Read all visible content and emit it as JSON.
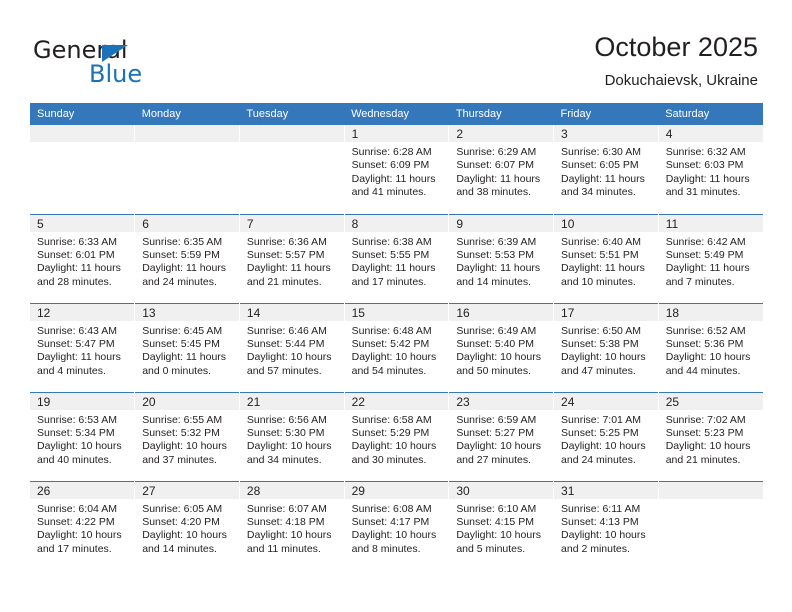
{
  "brand": {
    "name_part1": "General",
    "name_part2": "Blue",
    "accent_color": "#1b72b8"
  },
  "header": {
    "title": "October 2025",
    "subtitle": "Dokuchaievsk, Ukraine"
  },
  "calendar": {
    "header_color": "#3577bb",
    "daynum_band_color": "#f0f0f0",
    "weekday_headers": [
      "Sunday",
      "Monday",
      "Tuesday",
      "Wednesday",
      "Thursday",
      "Friday",
      "Saturday"
    ],
    "labels": {
      "sunrise_prefix": "Sunrise:",
      "sunset_prefix": "Sunset:",
      "daylight_prefix": "Daylight:"
    },
    "weeks": [
      [
        {
          "day": "",
          "empty": true
        },
        {
          "day": "",
          "empty": true
        },
        {
          "day": "",
          "empty": true
        },
        {
          "day": "1",
          "sunrise": "Sunrise: 6:28 AM",
          "sunset": "Sunset: 6:09 PM",
          "daylight": "Daylight: 11 hours and 41 minutes."
        },
        {
          "day": "2",
          "sunrise": "Sunrise: 6:29 AM",
          "sunset": "Sunset: 6:07 PM",
          "daylight": "Daylight: 11 hours and 38 minutes."
        },
        {
          "day": "3",
          "sunrise": "Sunrise: 6:30 AM",
          "sunset": "Sunset: 6:05 PM",
          "daylight": "Daylight: 11 hours and 34 minutes."
        },
        {
          "day": "4",
          "sunrise": "Sunrise: 6:32 AM",
          "sunset": "Sunset: 6:03 PM",
          "daylight": "Daylight: 11 hours and 31 minutes."
        }
      ],
      [
        {
          "day": "5",
          "sunrise": "Sunrise: 6:33 AM",
          "sunset": "Sunset: 6:01 PM",
          "daylight": "Daylight: 11 hours and 28 minutes."
        },
        {
          "day": "6",
          "sunrise": "Sunrise: 6:35 AM",
          "sunset": "Sunset: 5:59 PM",
          "daylight": "Daylight: 11 hours and 24 minutes."
        },
        {
          "day": "7",
          "sunrise": "Sunrise: 6:36 AM",
          "sunset": "Sunset: 5:57 PM",
          "daylight": "Daylight: 11 hours and 21 minutes."
        },
        {
          "day": "8",
          "sunrise": "Sunrise: 6:38 AM",
          "sunset": "Sunset: 5:55 PM",
          "daylight": "Daylight: 11 hours and 17 minutes."
        },
        {
          "day": "9",
          "sunrise": "Sunrise: 6:39 AM",
          "sunset": "Sunset: 5:53 PM",
          "daylight": "Daylight: 11 hours and 14 minutes."
        },
        {
          "day": "10",
          "sunrise": "Sunrise: 6:40 AM",
          "sunset": "Sunset: 5:51 PM",
          "daylight": "Daylight: 11 hours and 10 minutes."
        },
        {
          "day": "11",
          "sunrise": "Sunrise: 6:42 AM",
          "sunset": "Sunset: 5:49 PM",
          "daylight": "Daylight: 11 hours and 7 minutes."
        }
      ],
      [
        {
          "day": "12",
          "sunrise": "Sunrise: 6:43 AM",
          "sunset": "Sunset: 5:47 PM",
          "daylight": "Daylight: 11 hours and 4 minutes."
        },
        {
          "day": "13",
          "sunrise": "Sunrise: 6:45 AM",
          "sunset": "Sunset: 5:45 PM",
          "daylight": "Daylight: 11 hours and 0 minutes."
        },
        {
          "day": "14",
          "sunrise": "Sunrise: 6:46 AM",
          "sunset": "Sunset: 5:44 PM",
          "daylight": "Daylight: 10 hours and 57 minutes."
        },
        {
          "day": "15",
          "sunrise": "Sunrise: 6:48 AM",
          "sunset": "Sunset: 5:42 PM",
          "daylight": "Daylight: 10 hours and 54 minutes."
        },
        {
          "day": "16",
          "sunrise": "Sunrise: 6:49 AM",
          "sunset": "Sunset: 5:40 PM",
          "daylight": "Daylight: 10 hours and 50 minutes."
        },
        {
          "day": "17",
          "sunrise": "Sunrise: 6:50 AM",
          "sunset": "Sunset: 5:38 PM",
          "daylight": "Daylight: 10 hours and 47 minutes."
        },
        {
          "day": "18",
          "sunrise": "Sunrise: 6:52 AM",
          "sunset": "Sunset: 5:36 PM",
          "daylight": "Daylight: 10 hours and 44 minutes."
        }
      ],
      [
        {
          "day": "19",
          "sunrise": "Sunrise: 6:53 AM",
          "sunset": "Sunset: 5:34 PM",
          "daylight": "Daylight: 10 hours and 40 minutes."
        },
        {
          "day": "20",
          "sunrise": "Sunrise: 6:55 AM",
          "sunset": "Sunset: 5:32 PM",
          "daylight": "Daylight: 10 hours and 37 minutes."
        },
        {
          "day": "21",
          "sunrise": "Sunrise: 6:56 AM",
          "sunset": "Sunset: 5:30 PM",
          "daylight": "Daylight: 10 hours and 34 minutes."
        },
        {
          "day": "22",
          "sunrise": "Sunrise: 6:58 AM",
          "sunset": "Sunset: 5:29 PM",
          "daylight": "Daylight: 10 hours and 30 minutes."
        },
        {
          "day": "23",
          "sunrise": "Sunrise: 6:59 AM",
          "sunset": "Sunset: 5:27 PM",
          "daylight": "Daylight: 10 hours and 27 minutes."
        },
        {
          "day": "24",
          "sunrise": "Sunrise: 7:01 AM",
          "sunset": "Sunset: 5:25 PM",
          "daylight": "Daylight: 10 hours and 24 minutes."
        },
        {
          "day": "25",
          "sunrise": "Sunrise: 7:02 AM",
          "sunset": "Sunset: 5:23 PM",
          "daylight": "Daylight: 10 hours and 21 minutes."
        }
      ],
      [
        {
          "day": "26",
          "sunrise": "Sunrise: 6:04 AM",
          "sunset": "Sunset: 4:22 PM",
          "daylight": "Daylight: 10 hours and 17 minutes."
        },
        {
          "day": "27",
          "sunrise": "Sunrise: 6:05 AM",
          "sunset": "Sunset: 4:20 PM",
          "daylight": "Daylight: 10 hours and 14 minutes."
        },
        {
          "day": "28",
          "sunrise": "Sunrise: 6:07 AM",
          "sunset": "Sunset: 4:18 PM",
          "daylight": "Daylight: 10 hours and 11 minutes."
        },
        {
          "day": "29",
          "sunrise": "Sunrise: 6:08 AM",
          "sunset": "Sunset: 4:17 PM",
          "daylight": "Daylight: 10 hours and 8 minutes."
        },
        {
          "day": "30",
          "sunrise": "Sunrise: 6:10 AM",
          "sunset": "Sunset: 4:15 PM",
          "daylight": "Daylight: 10 hours and 5 minutes."
        },
        {
          "day": "31",
          "sunrise": "Sunrise: 6:11 AM",
          "sunset": "Sunset: 4:13 PM",
          "daylight": "Daylight: 10 hours and 2 minutes."
        },
        {
          "day": "",
          "empty": true
        }
      ]
    ]
  }
}
